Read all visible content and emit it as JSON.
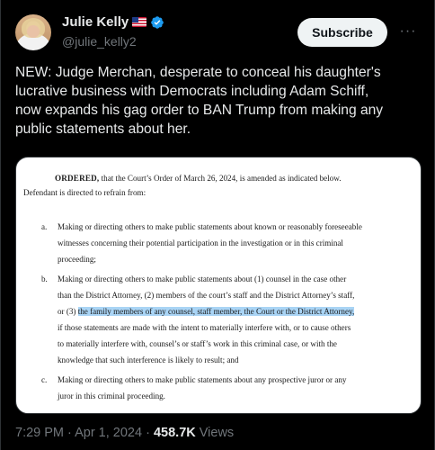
{
  "author": {
    "display_name": "Julie Kelly",
    "handle": "@julie_kelly2"
  },
  "header": {
    "subscribe_label": "Subscribe",
    "more_label": "···"
  },
  "tweet": {
    "text_lines": [
      "NEW: Judge Merchan, desperate to conceal his daughter's",
      "lucrative business with Democrats including Adam Schiff,",
      "now expands his gag order to BAN Trump from making any",
      "public statements about her."
    ]
  },
  "document": {
    "ordered_bold": "ORDERED,",
    "ordered_rest": " that the Court’s Order of March 26, 2024, is amended as indicated below.",
    "intro_line_2": "Defendant is directed to refrain from:",
    "item_a": {
      "marker": "a.",
      "lines": [
        "Making or directing others to make public statements about known or reasonably foreseeable",
        "witnesses concerning their potential participation in the investigation or in this criminal",
        "proceeding;"
      ]
    },
    "item_b": {
      "marker": "b.",
      "lines": [
        "Making or directing others to make public statements about (1) counsel in the case other",
        "than the District Attorney, (2) members of the court’s staff and the District Attorney’s staff,"
      ],
      "line3_prefix": "or (3) ",
      "line3_highlight": "the family members of any counsel, staff member, the Court or the District Attorney,",
      "lines_after": [
        "if those statements are made with the intent to materially interfere with, or to cause others",
        "to materially interfere with, counsel’s or staff’s work in this criminal case, or with the",
        "knowledge that such interference is likely to result; and"
      ]
    },
    "item_c": {
      "marker": "c.",
      "lines": [
        "Making or directing others to make public statements about any prospective juror or any",
        "juror in this criminal proceeding."
      ]
    }
  },
  "footer": {
    "time": "7:29 PM",
    "separator": " · ",
    "date": "Apr 1, 2024",
    "views_count": "458.7K",
    "views_label": " Views"
  },
  "colors": {
    "background": "#000000",
    "text": "#e7e9ea",
    "secondary": "#71767b",
    "verified": "#1d9bf0",
    "highlight": "#a9d4f5"
  }
}
